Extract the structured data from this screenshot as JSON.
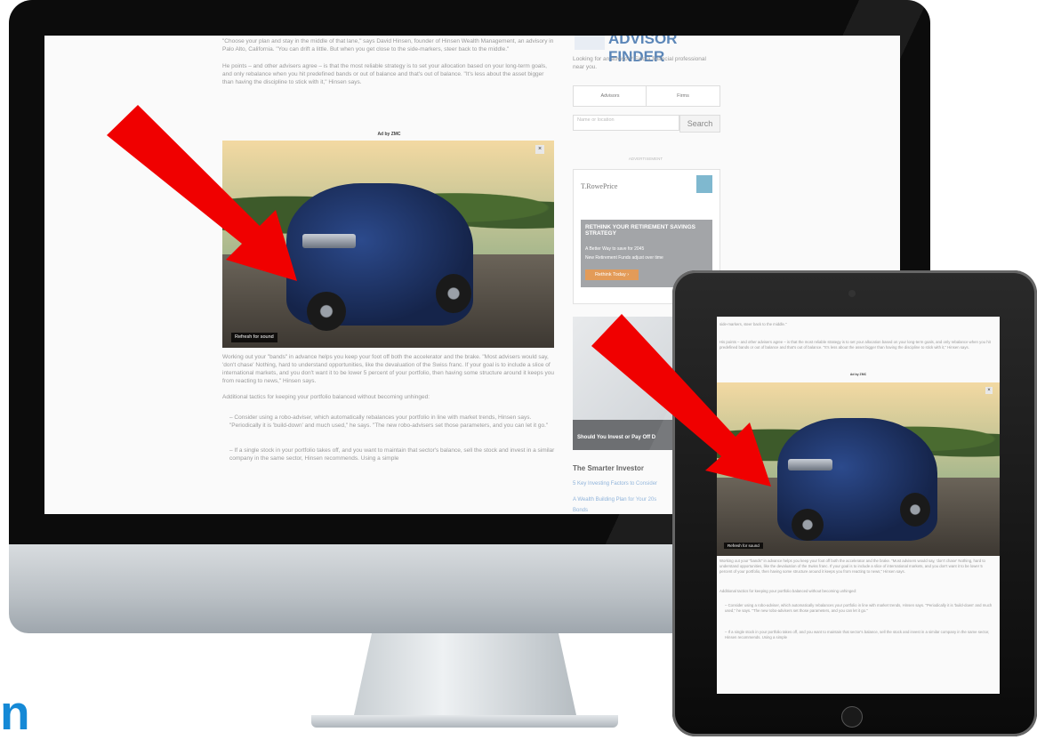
{
  "brand_fragment": "n",
  "colors": {
    "arrow": "#f00000",
    "screen_bg": "#fafafa",
    "brand_blue": "#1589d6"
  },
  "monitor": {
    "article": {
      "para1": "\"Choose your plan and stay in the middle of that lane,\" says David Hinsen, founder of Hinsen Wealth Management, an advisory in Palo Alto, California. \"You can drift a little. But when you get close to the side-markers, steer back to the middle.\"",
      "para2": "He points – and other advisers agree – is that the most reliable strategy is to set your allocation based on your long-term goals, and only rebalance when you hit predefined bands or out of balance and that's out of balance. \"It's less about the asset bigger than having the discipline to stick with it,\" Hinsen says.",
      "ad_label": "Ad by ZMC",
      "caption": "Refresh for sound",
      "para3": "Working out your \"bands\" in advance helps you keep your foot off both the accelerator and the brake. \"Most advisers would say, 'don't chase' Nothing, hard to understand opportunities, like the devaluation of the Swiss franc. If your goal is to include a slice of international markets, and you don't want it to be lower 5 percent of your portfolio, then having some structure around it keeps you from reacting to news,\" Hinsen says.",
      "para4": "Additional tactics for keeping your portfolio balanced without becoming unhinged:",
      "para5": "– Consider using a robo-adviser, which automatically rebalances your portfolio in line with market trends, Hinsen says. \"Periodically it is 'build-down' and much used,\" he says. \"The new robo-advisers set those parameters, and you can let it go.\"",
      "para6": "– If a single stock in your portfolio takes off, and you want to maintain that sector's balance, sell the stock and invest in a similar company in the same sector, Hinsen recommends. Using a simple"
    },
    "sidebar": {
      "logo": "ADVISOR FINDER",
      "intro": "Looking for an advisor? Find a financial professional near you.",
      "tabs": [
        "Advisors",
        "Firms"
      ],
      "search_placeholder": "Name or location",
      "search_button": "Search",
      "advertisement": "ADVERTISEMENT",
      "ad_brand": "T.RowePrice",
      "ad_headline": "RETHINK YOUR RETIREMENT SAVINGS STRATEGY",
      "ad_bullets": [
        "A Better Way to save for 2045",
        "New Retirement Funds adjust over time"
      ],
      "ad_button": "Rethink Today ›",
      "promo_caption": "Should You Invest or Pay Off D",
      "section_title": "The Smarter Investor",
      "links": [
        "5 Key Investing Factors to Consider",
        "A Wealth Building Plan for Your 20s",
        "Bonds"
      ]
    }
  },
  "tablet": {
    "line1": "side-markers, steer back to the middle.\"",
    "para2": "His points – and other advisers agree – is that the most reliable strategy is to set your allocation based on your long-term goals, and only rebalance when you hit predefined bands or out of balance and that's out of balance. \"It's less about the asset bigger than having the discipline to stick with it,\" Hinsen says.",
    "ad_label": "Ad by ZMC",
    "caption": "Refresh for sound",
    "para3": "Working out your \"bands\" in advance helps you keep your foot off both the accelerator and the brake. \"Most advisers would say, 'don't chase' Nothing, hard to understand opportunities, like the devaluation of the Swiss franc. If your goal is to include a slice of international markets, and you don't want it to be lower 5 percent of your portfolio, then having some structure around it keeps you from reacting to news,\" Hinsen says.",
    "para4": "Additional tactics for keeping your portfolio balanced without becoming unhinged:",
    "para5": "– Consider using a robo-adviser, which automatically rebalances your portfolio in line with market trends, Hinsen says. \"Periodically it is 'build-down' and much used,\" he says. \"The new robo-advisers set those parameters, and you can let it go.\"",
    "para6": "– If a single stock in your portfolio takes off, and you want to maintain that sector's balance, sell the stock and invest in a similar company in the same sector, Hinsen recommends. Using a simple"
  }
}
